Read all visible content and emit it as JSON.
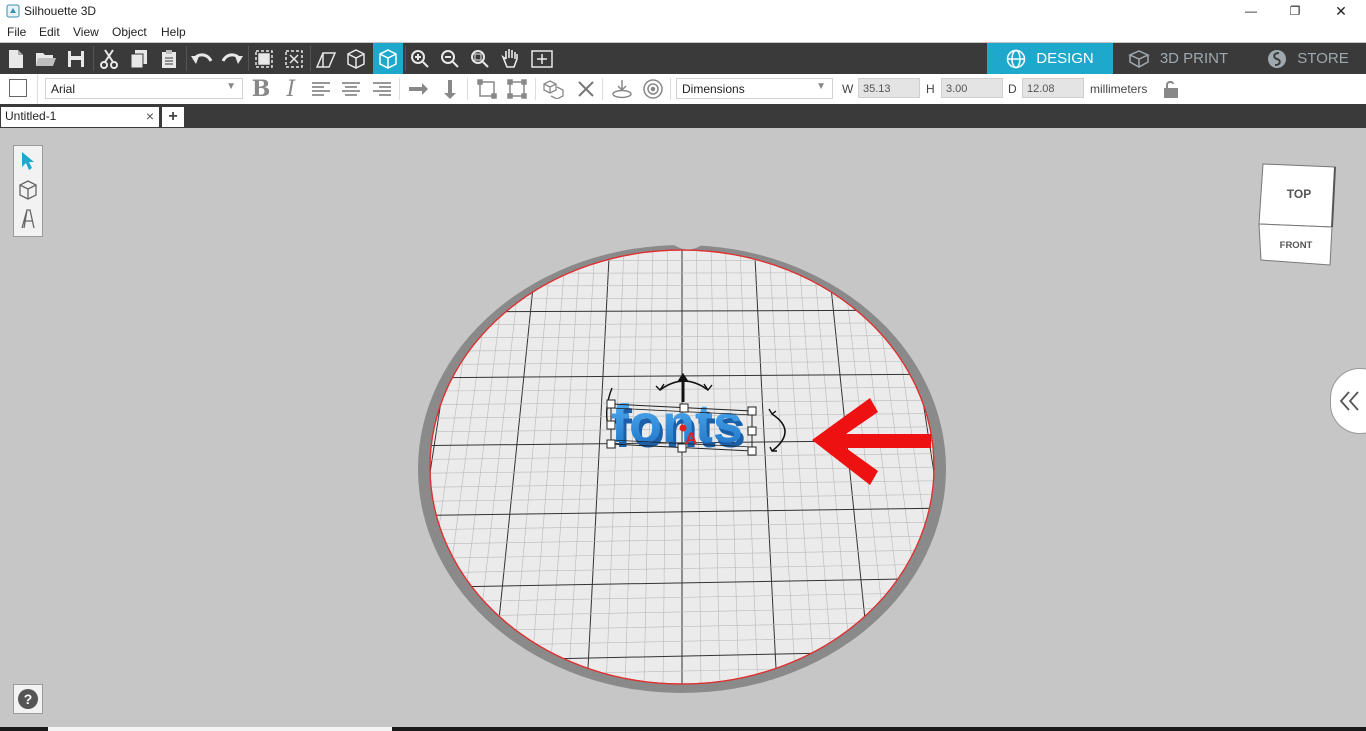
{
  "window": {
    "title": "Silhouette 3D",
    "minimize": "—",
    "maximize": "❐",
    "close": "✕"
  },
  "menu": {
    "items": [
      "File",
      "Edit",
      "View",
      "Object",
      "Help"
    ]
  },
  "nav_tabs": [
    {
      "label": "DESIGN",
      "active": true
    },
    {
      "label": "3D PRINT",
      "active": false
    },
    {
      "label": "STORE",
      "active": false
    }
  ],
  "text_toolbar": {
    "font": "Arial",
    "view_mode": "Dimensions",
    "w_label": "W",
    "w_value": "35.13",
    "h_label": "H",
    "h_value": "3.00",
    "d_label": "D",
    "d_value": "12.08",
    "units": "millimeters"
  },
  "document": {
    "tab_title": "Untitled-1",
    "close": "×",
    "add": "+"
  },
  "viewcube": {
    "top_label": "TOP",
    "front_label": "FRONT"
  },
  "canvas_object": {
    "text": "fonts",
    "anchor_letter": "A"
  },
  "help": {
    "label": "?"
  },
  "colors": {
    "accent": "#1ea8cc",
    "toolbar_dark": "#3a3a3a",
    "object_blue": "#2d8fe0",
    "arrow_red": "#ee1111"
  }
}
